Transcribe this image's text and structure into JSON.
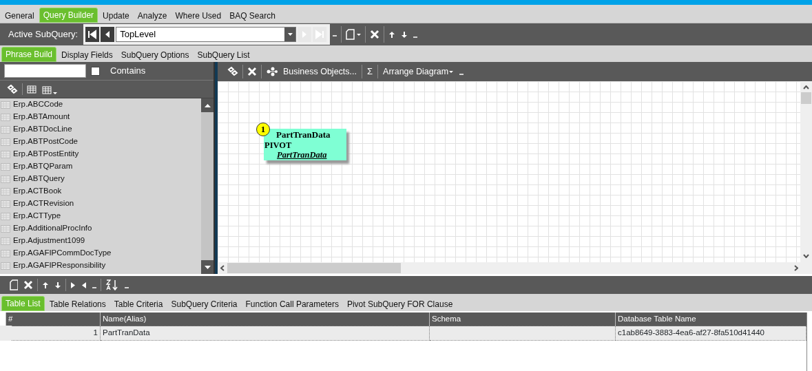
{
  "tabs": [
    {
      "label": "General",
      "selected": false
    },
    {
      "label": "Query Builder",
      "selected": true
    },
    {
      "label": "Update",
      "selected": false
    },
    {
      "label": "Analyze",
      "selected": false
    },
    {
      "label": "Where Used",
      "selected": false
    },
    {
      "label": "BAQ Search",
      "selected": false
    }
  ],
  "subquery_toolbar": {
    "label": "Active SubQuery:",
    "value": "TopLevel",
    "nav_buttons": [
      {
        "kind": "first",
        "disabled": false
      },
      {
        "kind": "previous",
        "disabled": false
      },
      {
        "kind": "next",
        "disabled": true
      },
      {
        "kind": "last",
        "disabled": true
      }
    ]
  },
  "subtabs": [
    {
      "label": "Phrase Build",
      "selected": true
    },
    {
      "label": "Display Fields",
      "selected": false
    },
    {
      "label": "SubQuery Options",
      "selected": false
    },
    {
      "label": "SubQuery List",
      "selected": false
    }
  ],
  "table_search": {
    "contains_label": "Contains",
    "contains_checked": false
  },
  "tables": [
    "Erp.ABCCode",
    "Erp.ABTAmount",
    "Erp.ABTDocLine",
    "Erp.ABTPostCode",
    "Erp.ABTPostEntity",
    "Erp.ABTQParam",
    "Erp.ABTQuery",
    "Erp.ACTBook",
    "Erp.ACTRevision",
    "Erp.ACTType",
    "Erp.AdditionalProcInfo",
    "Erp.Adjustment1099",
    "Erp.AGAFIPCommDocType",
    "Erp.AGAFIPResponsibility"
  ],
  "diagram_toolbar": {
    "business_objects": "Business Objects...",
    "sum": "Σ",
    "arrange": "Arrange Diagram"
  },
  "diagram": {
    "nodes": [
      {
        "number": "1",
        "title": "PartTranData",
        "type": "PIVOT",
        "alias": "PartTranData"
      }
    ]
  },
  "bottom_tabs": [
    {
      "label": "Table List",
      "selected": true
    },
    {
      "label": "Table Relations",
      "selected": false
    },
    {
      "label": "Table Criteria",
      "selected": false
    },
    {
      "label": "SubQuery Criteria",
      "selected": false
    },
    {
      "label": "Function Call Parameters",
      "selected": false
    },
    {
      "label": "Pivot SubQuery FOR Clause",
      "selected": false
    }
  ],
  "table": {
    "columns": [
      "#",
      "Name(Alias)",
      "Schema",
      "Database Table Name"
    ],
    "rows": [
      {
        "number": "1",
        "name": "PartTranData",
        "database_table_name": "c1ab8649-3883-4ea6-af27-8fa510d41440"
      }
    ]
  }
}
